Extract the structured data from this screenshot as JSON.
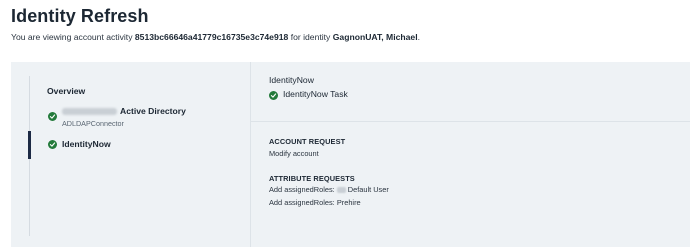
{
  "page": {
    "title": "Identity Refresh",
    "subtitle_prefix": "You are viewing account activity",
    "activity_id": "8513bc66646a41779c16735e3c74e918",
    "subtitle_mid": "for identity",
    "identity_name": "GagnonUAT, Michael",
    "subtitle_suffix": "."
  },
  "sidebar": {
    "overview_label": "Overview",
    "steps": [
      {
        "name": "Active Directory",
        "sub": "ADLDAPConnector",
        "status": "success",
        "status_icon": "check-circle-icon"
      },
      {
        "name": "IdentityNow",
        "status": "success",
        "status_icon": "check-circle-icon",
        "selected": true
      }
    ]
  },
  "detail": {
    "app_name": "IdentityNow",
    "task_label": "IdentityNow Task",
    "account_request": {
      "heading": "ACCOUNT REQUEST",
      "value": "Modify account"
    },
    "attribute_requests": {
      "heading": "ATTRIBUTE REQUESTS",
      "items": [
        {
          "prefix": "Add assignedRoles:",
          "value": "Default User"
        },
        {
          "prefix": "Add assignedRoles:",
          "value": "Prehire"
        }
      ]
    }
  },
  "colors": {
    "success": "#237a3b",
    "selected_bar": "#1c2a44",
    "panel_bg": "#eef2f5"
  }
}
